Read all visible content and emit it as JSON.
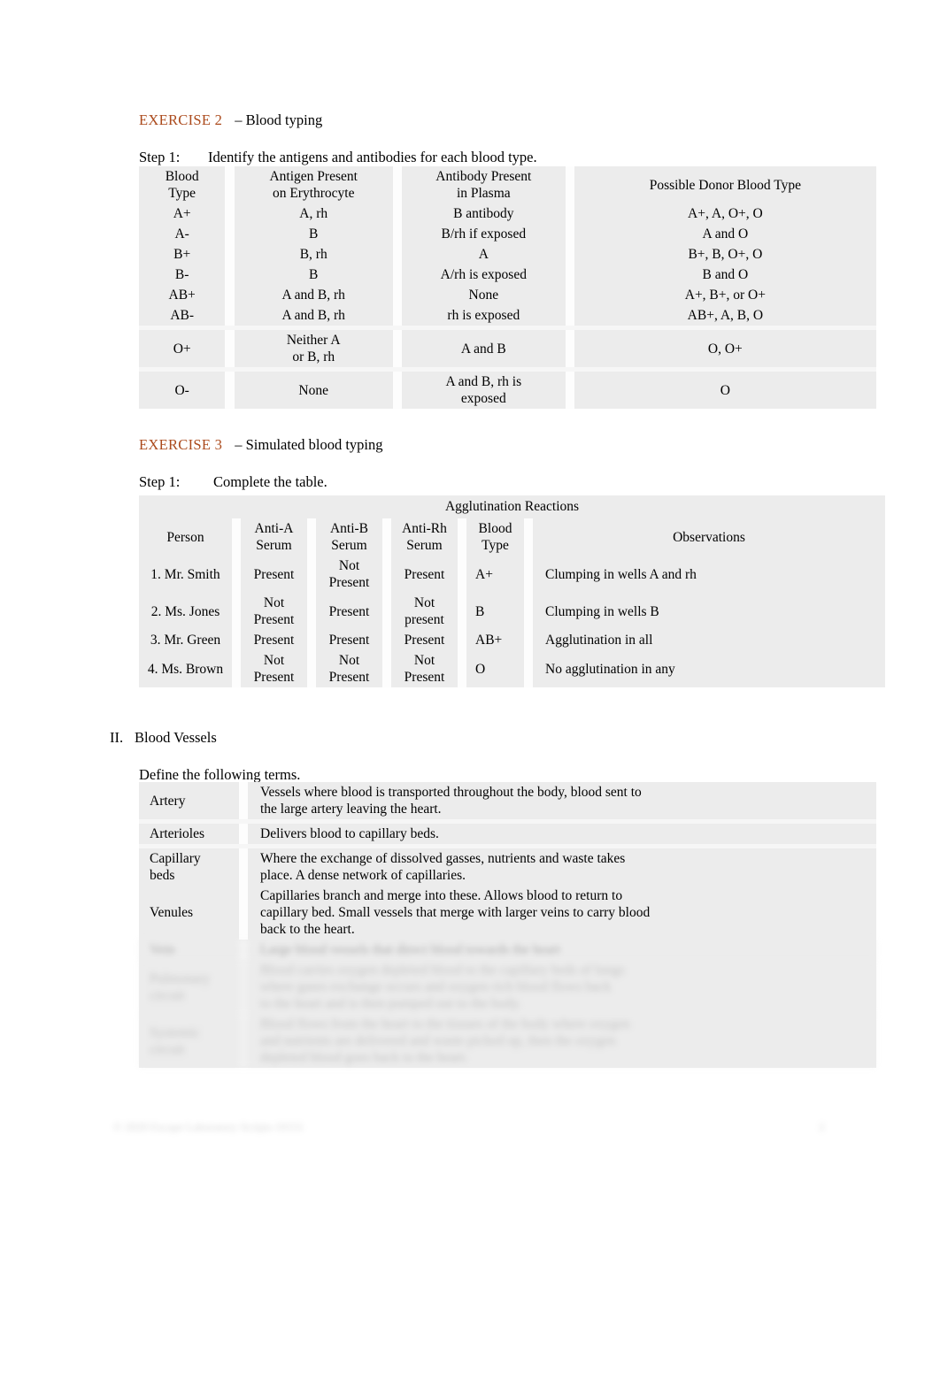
{
  "document": {
    "exercise2": {
      "label": "EXERCISE 2",
      "dash_title": "–  Blood typing",
      "step": {
        "label": "Step 1:",
        "text": "Identify the antigens and antibodies for each blood type."
      }
    },
    "blood_type_table": {
      "headers": [
        "Blood\nType",
        "Antigen Present\non Erythrocyte",
        "Antibody Present\nin Plasma",
        "Possible Donor Blood Type"
      ],
      "header_lines": {
        "blood_type": [
          "Blood",
          "Type"
        ],
        "antigen": [
          "Antigen Present",
          "on Erythrocyte"
        ],
        "antibody": [
          "Antibody Present",
          "in Plasma"
        ],
        "donor": [
          "Possible Donor Blood Type"
        ]
      },
      "rows": [
        {
          "type": "A+",
          "antigen": "A, rh",
          "antibody": "B antibody",
          "donor": "A+, A, O+, O"
        },
        {
          "type": "A-",
          "antigen": "B",
          "antibody": "B/rh if exposed",
          "donor": "A and O"
        },
        {
          "type": "B+",
          "antigen": "B, rh",
          "antibody": "A",
          "donor": "B+, B, O+, O"
        },
        {
          "type": "B-",
          "antigen": "B",
          "antibody": "A/rh is exposed",
          "donor": "B and O"
        },
        {
          "type": "AB+",
          "antigen": "A and B, rh",
          "antibody": "None",
          "donor": "A+, B+, or O+"
        },
        {
          "type": "AB-",
          "antigen": "A and B, rh",
          "antibody": "rh is exposed",
          "donor": "AB+, A, B, O"
        },
        {
          "type": "O+",
          "antigen": "Neither A\nor B, rh",
          "antibody": "A and B",
          "donor": "O, O+"
        },
        {
          "type": "O-",
          "antigen": "None",
          "antibody": "A and B, rh is\nexposed",
          "donor": "O"
        }
      ],
      "multiline": {
        "o_plus_antigen": [
          "Neither A",
          "or B, rh"
        ],
        "o_minus_antibody": [
          "A and B, rh is",
          "exposed"
        ]
      }
    },
    "exercise3": {
      "label": "EXERCISE 3",
      "dash_title": "–  Simulated blood typing",
      "step": {
        "label": "Step 1:",
        "text": "Complete the table."
      }
    },
    "agglutination_table": {
      "supertitle": "Agglutination Reactions",
      "headers": {
        "person": "Person",
        "anti_a": [
          "Anti-A",
          "Serum"
        ],
        "anti_b": [
          "Anti-B",
          "Serum"
        ],
        "anti_rh": [
          "Anti-Rh",
          "Serum"
        ],
        "blood_type": [
          "Blood",
          "Type"
        ],
        "observations": "Observations"
      },
      "rows": [
        {
          "person": "1. Mr. Smith",
          "anti_a": "Present",
          "anti_b": "Not\nPresent",
          "anti_b_lines": [
            "Not",
            "Present"
          ],
          "anti_rh": "Present",
          "blood_type": "A+",
          "observations": "Clumping in wells A and rh"
        },
        {
          "person": "2. Ms. Jones",
          "anti_a": "Not\nPresent",
          "anti_a_lines": [
            "Not",
            "Present"
          ],
          "anti_b": "Present",
          "anti_rh": "Not\npresent",
          "anti_rh_lines": [
            "Not",
            "present"
          ],
          "blood_type": "B",
          "observations": "Clumping in wells B"
        },
        {
          "person": "3. Mr. Green",
          "anti_a": "Present",
          "anti_b": "Present",
          "anti_rh": "Present",
          "blood_type": "AB+",
          "observations": "Agglutination in all"
        },
        {
          "person": "4. Ms. Brown",
          "anti_a": "Not\nPresent",
          "anti_a_lines": [
            "Not",
            "Present"
          ],
          "anti_b": "Not\nPresent",
          "anti_b_lines": [
            "Not",
            "Present"
          ],
          "anti_rh": "Not\nPresent",
          "anti_rh_lines": [
            "Not",
            "Present"
          ],
          "blood_type": "O",
          "observations": "No agglutination in any"
        }
      ]
    },
    "blood_vessels": {
      "number": "II.",
      "title": "Blood Vessels",
      "instruction": "Define the following terms.",
      "rows": [
        {
          "term": "Artery",
          "term_lines": [
            "Artery"
          ],
          "definition_lines": [
            "Vessels where blood is transported throughout the body, blood sent to",
            "the large artery leaving the heart."
          ]
        },
        {
          "term": "Arterioles",
          "term_lines": [
            "Arterioles"
          ],
          "definition_lines": [
            " Delivers blood to capillary beds."
          ]
        },
        {
          "term": "Capillary beds",
          "term_lines": [
            "Capillary",
            "beds"
          ],
          "definition_lines": [
            "Where the exchange of dissolved gasses, nutrients and waste takes",
            "place. A dense network of capillaries."
          ]
        },
        {
          "term": "Venules",
          "term_lines": [
            "Venules"
          ],
          "definition_lines": [
            "Capillaries branch and merge into these. Allows blood to return to",
            "capillary bed. Small vessels that merge with larger veins to carry blood",
            "back to the heart."
          ]
        }
      ],
      "obscured_rows": [
        {
          "term_lines": [
            "Vein"
          ],
          "definition_lines": [
            "Large blood vessels that direct blood towards the heart"
          ]
        },
        {
          "term_lines": [
            "Pulmonary",
            "circuit"
          ],
          "definition_lines": [
            "Blood carries oxygen depleted blood to the capillary beds of lungs",
            "where gases exchange occurs and oxygen rich blood flows back",
            "to the heart and is then pumped out to the body."
          ]
        },
        {
          "term_lines": [
            "Systemic",
            "circuit"
          ],
          "definition_lines": [
            "Blood flows from the heart to the tissues of the body where oxygen",
            "and nutrients are delivered and waste picked up, then the oxygen",
            "depleted blood goes back to the heart."
          ]
        }
      ]
    },
    "footer": {
      "left": "© 2020 Escape Laboratory Scripts 10151",
      "right": "2"
    }
  }
}
